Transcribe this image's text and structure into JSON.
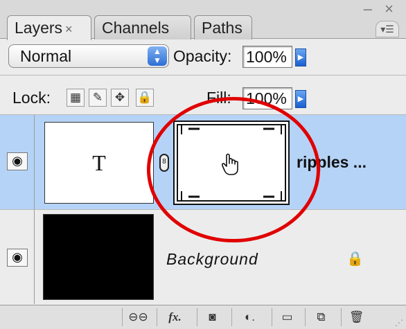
{
  "tabs": [
    {
      "label": "Layers",
      "close": "×"
    },
    {
      "label": "Channels"
    },
    {
      "label": "Paths"
    }
  ],
  "window_controls": "– ×",
  "blend_mode": {
    "value": "Normal"
  },
  "opacity": {
    "label": "Opacity:",
    "value": "100%"
  },
  "lock": {
    "label": "Lock:"
  },
  "fill": {
    "label": "Fill:",
    "value": "100%"
  },
  "layers": [
    {
      "name": "ripples ...",
      "thumb_text": "T",
      "selected": true
    },
    {
      "name": "Background",
      "locked": true
    }
  ],
  "colors": {
    "selected_row": "#b5d3f7",
    "annotation": "#e00000",
    "accent_blue": "#2e6ed6"
  },
  "icons": {
    "eye": "eye-icon",
    "chain": "chain-link-icon",
    "cursor": "hand-cursor-icon",
    "lock": "lock-icon",
    "toolbar": [
      "link-layers-icon",
      "fx-icon",
      "mask-icon",
      "adjustment-icon",
      "folder-icon",
      "new-layer-icon",
      "trash-icon"
    ]
  }
}
